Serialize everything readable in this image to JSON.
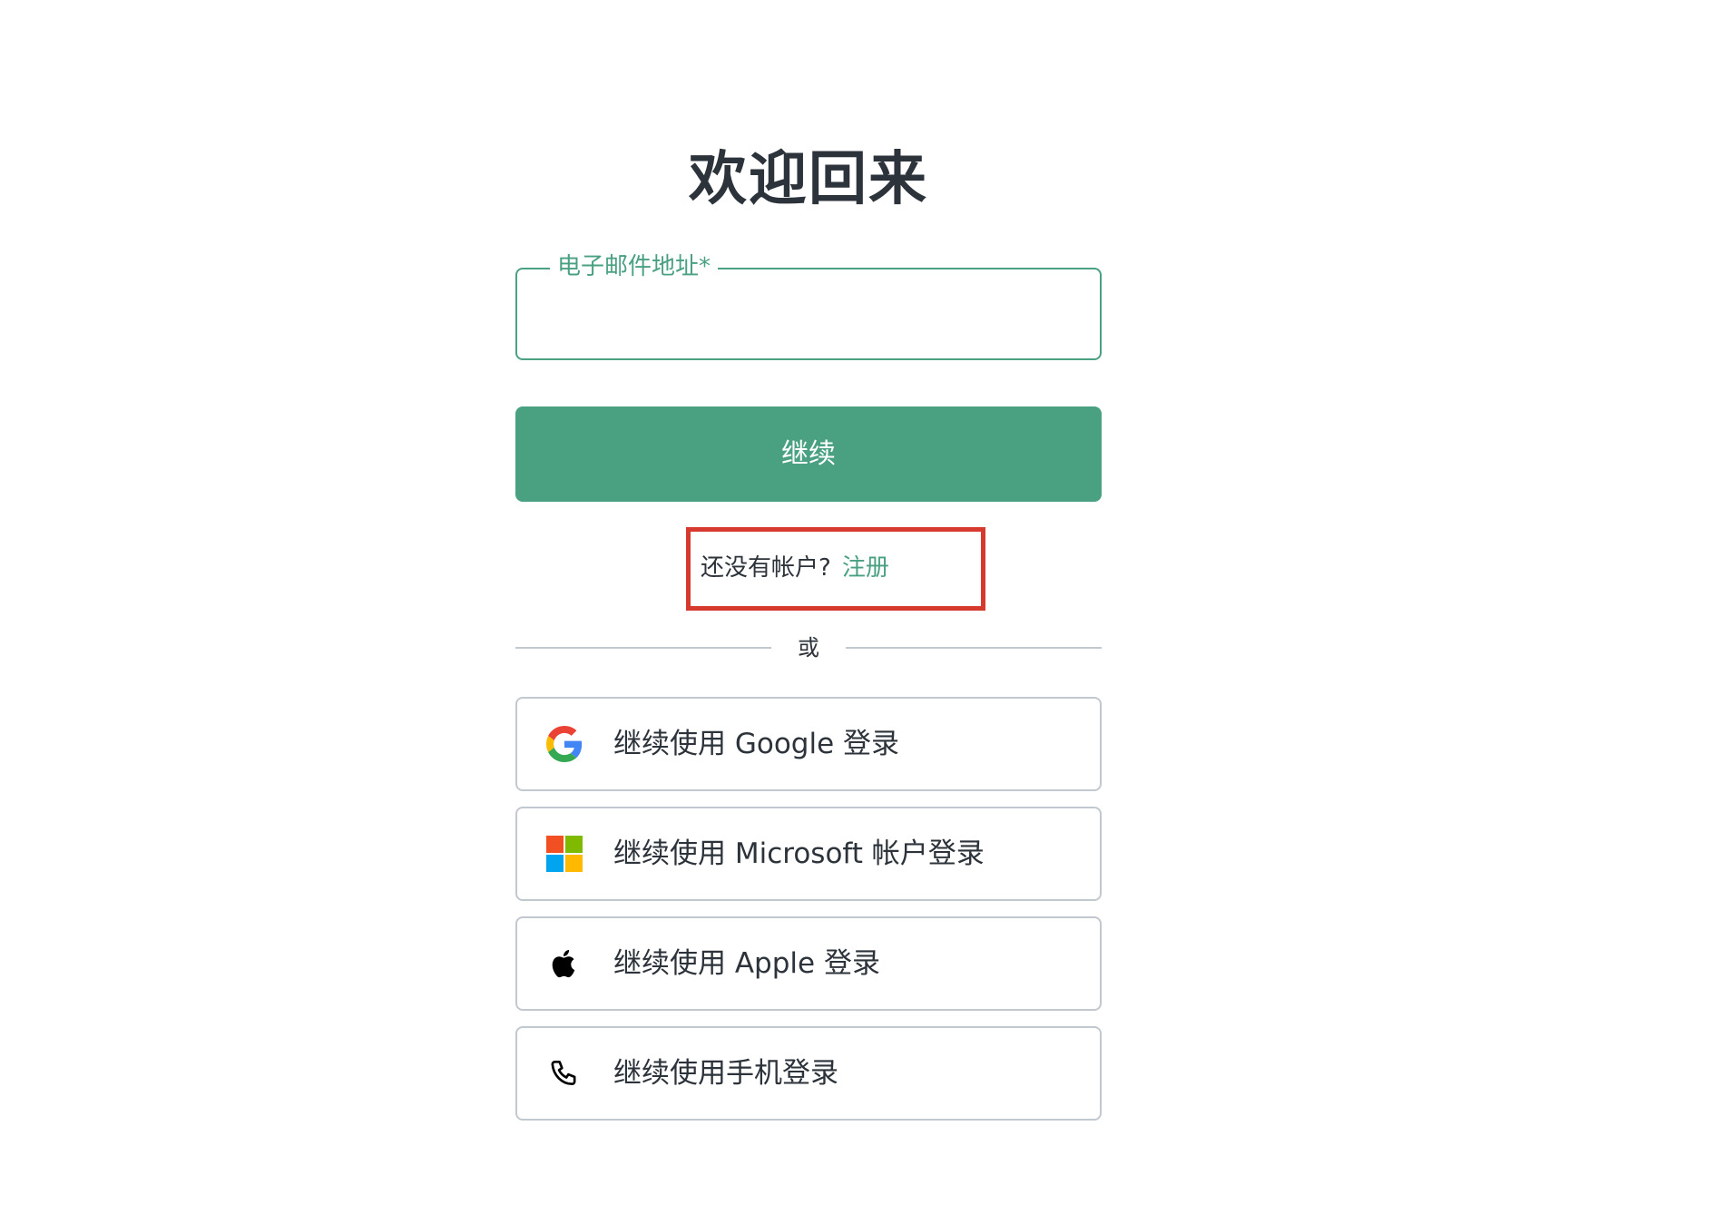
{
  "header": {
    "title": "欢迎回来"
  },
  "email": {
    "label": "电子邮件地址*",
    "value": "",
    "placeholder": ""
  },
  "continue_button": {
    "label": "继续"
  },
  "signup": {
    "prompt": "还没有帐户?",
    "link_label": "注册"
  },
  "divider": {
    "text": "或"
  },
  "social": [
    {
      "label": "继续使用 Google 登录",
      "icon": "google-icon"
    },
    {
      "label": "继续使用 Microsoft 帐户登录",
      "icon": "microsoft-icon"
    },
    {
      "label": "继续使用 Apple 登录",
      "icon": "apple-icon"
    },
    {
      "label": "继续使用手机登录",
      "icon": "phone-icon"
    }
  ],
  "colors": {
    "accent": "#4aa181",
    "highlight_box": "#d63a2f",
    "border": "#c2c8d0",
    "text": "#2d333a"
  }
}
